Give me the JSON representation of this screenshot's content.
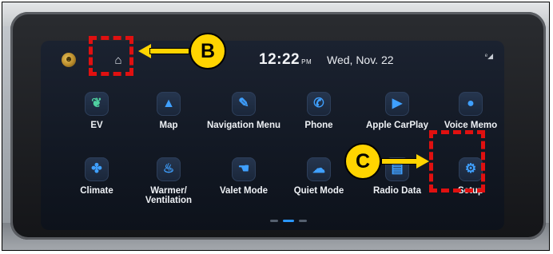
{
  "status_bar": {
    "time": "12:22",
    "ampm": "PM",
    "date": "Wed, Nov. 22",
    "home_icon": "home-icon",
    "signal_icon": "signal-icon"
  },
  "apps_row1": [
    {
      "label": "EV",
      "icon": "leaf-icon",
      "glyph": "❦",
      "color": "#4fd0a0"
    },
    {
      "label": "Map",
      "icon": "navigation-arrow-icon",
      "glyph": "▲",
      "color": "#3fa0ff"
    },
    {
      "label": "Navigation Menu",
      "icon": "pen-icon",
      "glyph": "✎",
      "color": "#3fa0ff"
    },
    {
      "label": "Phone",
      "icon": "phone-icon",
      "glyph": "✆",
      "color": "#3fa0ff"
    },
    {
      "label": "Apple CarPlay",
      "icon": "play-icon",
      "glyph": "▶",
      "color": "#3fa0ff"
    },
    {
      "label": "Voice Memo",
      "icon": "microphone-icon",
      "glyph": "●",
      "color": "#3fa0ff"
    }
  ],
  "apps_row2": [
    {
      "label": "Climate",
      "icon": "fan-icon",
      "glyph": "✤",
      "color": "#3fa0ff"
    },
    {
      "label": "Warmer/\nVentilation",
      "icon": "seat-heat-icon",
      "glyph": "♨",
      "color": "#3fa0ff"
    },
    {
      "label": "Valet Mode",
      "icon": "valet-icon",
      "glyph": "☚",
      "color": "#3fa0ff"
    },
    {
      "label": "Quiet Mode",
      "icon": "quiet-icon",
      "glyph": "☁",
      "color": "#3fa0ff"
    },
    {
      "label": "Radio Data",
      "icon": "radio-icon",
      "glyph": "▤",
      "color": "#3fa0ff"
    },
    {
      "label": "Setup",
      "icon": "gear-icon",
      "glyph": "⚙",
      "color": "#3fa0ff"
    }
  ],
  "callouts": {
    "b_label": "B",
    "c_label": "C"
  },
  "colors": {
    "accent": "#3fa0ff",
    "callout_red": "#e01010",
    "callout_yellow": "#ffd400"
  }
}
